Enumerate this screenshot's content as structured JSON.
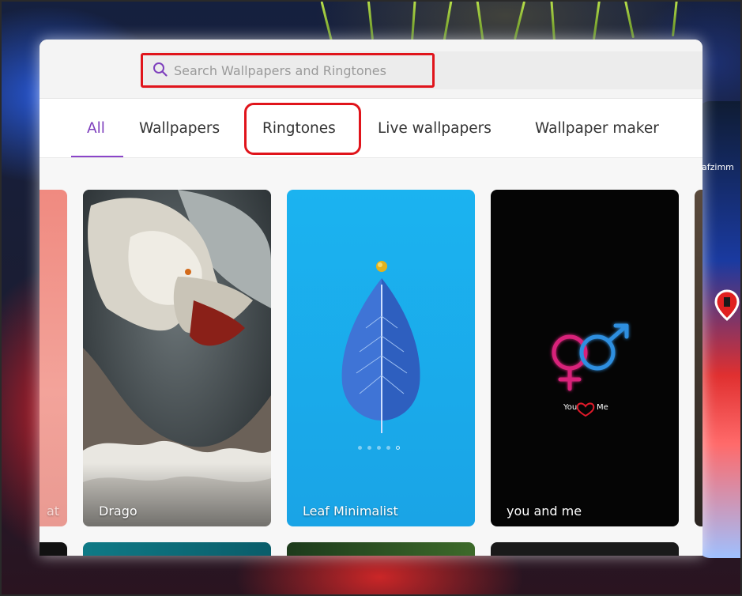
{
  "search": {
    "placeholder": "Search Wallpapers and Ringtones",
    "icon": "search-icon"
  },
  "tabs": [
    {
      "label": "All",
      "active": true
    },
    {
      "label": "Wallpapers",
      "active": false
    },
    {
      "label": "Ringtones",
      "active": false
    },
    {
      "label": "Live wallpapers",
      "active": false
    },
    {
      "label": "Wallpaper maker",
      "active": false
    }
  ],
  "cards": [
    {
      "title": "at"
    },
    {
      "title": "Drago"
    },
    {
      "title": "Leaf Minimalist",
      "dots_total": 5,
      "dots_active": 5
    },
    {
      "title": "you and me",
      "caption_left": "You",
      "caption_right": "Me"
    }
  ],
  "background": {
    "phone_label": "afzimm"
  },
  "colors": {
    "accent": "#7e3fbd",
    "highlight_box": "#e0141b",
    "leaf_card_bg": "#1ea6e8",
    "you_and_me_bg": "#050505"
  }
}
